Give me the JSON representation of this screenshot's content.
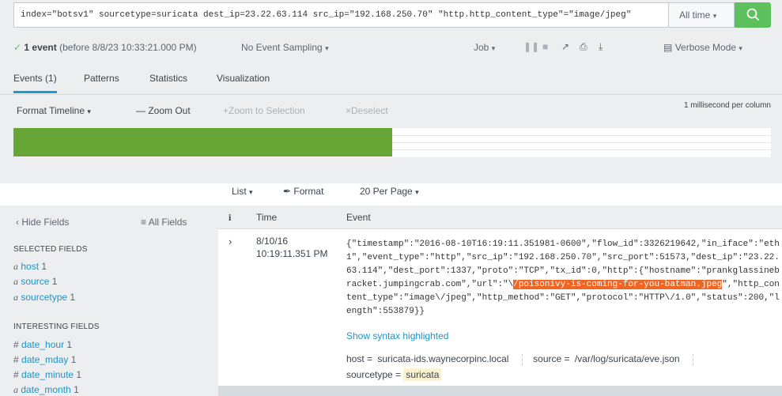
{
  "search": {
    "query": "index=\"botsv1\" sourcetype=suricata dest_ip=23.22.63.114 src_ip=\"192.168.250.70\" \"http.http_content_type\"=\"image/jpeg\"",
    "time_range": "All time",
    "accent_color": "#5cc05c"
  },
  "status": {
    "event_count": "1 event",
    "before": "(before 8/8/23 10:33:21.000 PM)",
    "sampling": "No Event Sampling",
    "job": "Job",
    "mode": "Verbose Mode"
  },
  "tabs": [
    {
      "label": "Events (1)",
      "active": true
    },
    {
      "label": "Patterns"
    },
    {
      "label": "Statistics"
    },
    {
      "label": "Visualization"
    }
  ],
  "timeline": {
    "format": "Format Timeline",
    "zoom_out": "Zoom Out",
    "zoom_selection": "Zoom to Selection",
    "deselect": "Deselect",
    "scale": "1 millisecond per column",
    "bar_fill": 0.5,
    "bar_color": "#65a637"
  },
  "list_controls": {
    "list": "List",
    "format": "Format",
    "per_page": "20 Per Page"
  },
  "fields_panel": {
    "hide": "Hide Fields",
    "all": "All Fields",
    "selected_title": "SELECTED FIELDS",
    "selected": [
      {
        "type": "a",
        "name": "host",
        "count": "1"
      },
      {
        "type": "a",
        "name": "source",
        "count": "1"
      },
      {
        "type": "a",
        "name": "sourcetype",
        "count": "1"
      }
    ],
    "interesting_title": "INTERESTING FIELDS",
    "interesting": [
      {
        "type": "#",
        "name": "date_hour",
        "count": "1"
      },
      {
        "type": "#",
        "name": "date_mday",
        "count": "1"
      },
      {
        "type": "#",
        "name": "date_minute",
        "count": "1"
      },
      {
        "type": "a",
        "name": "date_month",
        "count": "1"
      }
    ]
  },
  "events_table": {
    "col_info": "i",
    "col_time": "Time",
    "col_event": "Event",
    "row": {
      "date": "8/10/16",
      "time": "10:19:11.351 PM",
      "raw_before": "{\"timestamp\":\"2016-08-10T16:19:11.351981-0600\",\"flow_id\":3326219642,\"in_iface\":\"eth1\",\"event_type\":\"http\",\"src_ip\":\"192.168.250.70\",\"src_port\":51573,\"dest_ip\":\"23.22.63.114\",\"dest_port\":1337,\"proto\":\"TCP\",\"tx_id\":0,\"http\":{\"hostname\":\"prankglassinebracket.jumpingcrab.com\",\"url\":\"\\",
      "raw_highlight": "/poisonivy-is-coming-for-you-batman.jpeg",
      "raw_after": "\",\"http_content_type\":\"image\\/jpeg\",\"http_method\":\"GET\",\"protocol\":\"HTTP\\/1.0\",\"status\":200,\"length\":553879}}",
      "syntax_link": "Show syntax highlighted",
      "host_label": "host =",
      "host_value": "suricata-ids.waynecorpinc.local",
      "source_label": "source =",
      "source_value": "/var/log/suricata/eve.json",
      "sourcetype_label": "sourcetype =",
      "sourcetype_value": "suricata"
    }
  }
}
